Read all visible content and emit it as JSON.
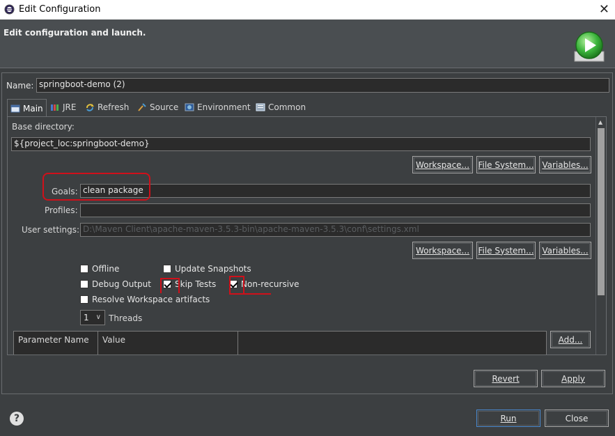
{
  "window": {
    "title": "Edit Configuration",
    "close_symbol": "✕"
  },
  "banner": {
    "message": "Edit configuration and launch.",
    "logo_icon": "run-icon"
  },
  "name": {
    "label": "Name:",
    "value": "springboot-demo (2)"
  },
  "tabs": [
    {
      "label": "Main",
      "icon": "main-tab-icon",
      "active": true
    },
    {
      "label": "JRE",
      "icon": "jre-icon"
    },
    {
      "label": "Refresh",
      "icon": "refresh-icon"
    },
    {
      "label": "Source",
      "icon": "source-icon"
    },
    {
      "label": "Environment",
      "icon": "environment-icon"
    },
    {
      "label": "Common",
      "icon": "common-icon"
    }
  ],
  "main": {
    "base_dir_label": "Base directory:",
    "base_dir_value": "${project_loc:springboot-demo}",
    "workspace_btn": "Workspace...",
    "filesystem_btn": "File System...",
    "variables_btn": "Variables...",
    "goals_label": "Goals:",
    "goals_value": "clean package",
    "profiles_label": "Profiles:",
    "profiles_value": "",
    "user_settings_label": "User settings:",
    "user_settings_value": "D:\\Maven Client\\apache-maven-3.5.3-bin\\apache-maven-3.5.3\\conf\\settings.xml",
    "checks": {
      "offline": {
        "label": "Offline",
        "checked": false
      },
      "update_snapshots": {
        "label": "Update Snapshots",
        "checked": false
      },
      "debug_output": {
        "label": "Debug Output",
        "checked": false
      },
      "skip_tests": {
        "label": "Skip Tests",
        "checked": true
      },
      "non_recursive": {
        "label": "Non-recursive",
        "checked": true
      },
      "resolve_workspace": {
        "label": "Resolve Workspace artifacts",
        "checked": false
      }
    },
    "threads_value": "1",
    "threads_label": "Threads",
    "param_table": {
      "columns": [
        "Parameter Name",
        "Value"
      ]
    },
    "add_btn": "Add..."
  },
  "footer": {
    "revert_btn": "Revert",
    "apply_btn": "Apply",
    "run_btn": "Run",
    "close_btn": "Close",
    "help_symbol": "?"
  },
  "colors": {
    "background": "#3c3f41",
    "annotation": "#d0101a",
    "run_green": "#3cb43c"
  }
}
